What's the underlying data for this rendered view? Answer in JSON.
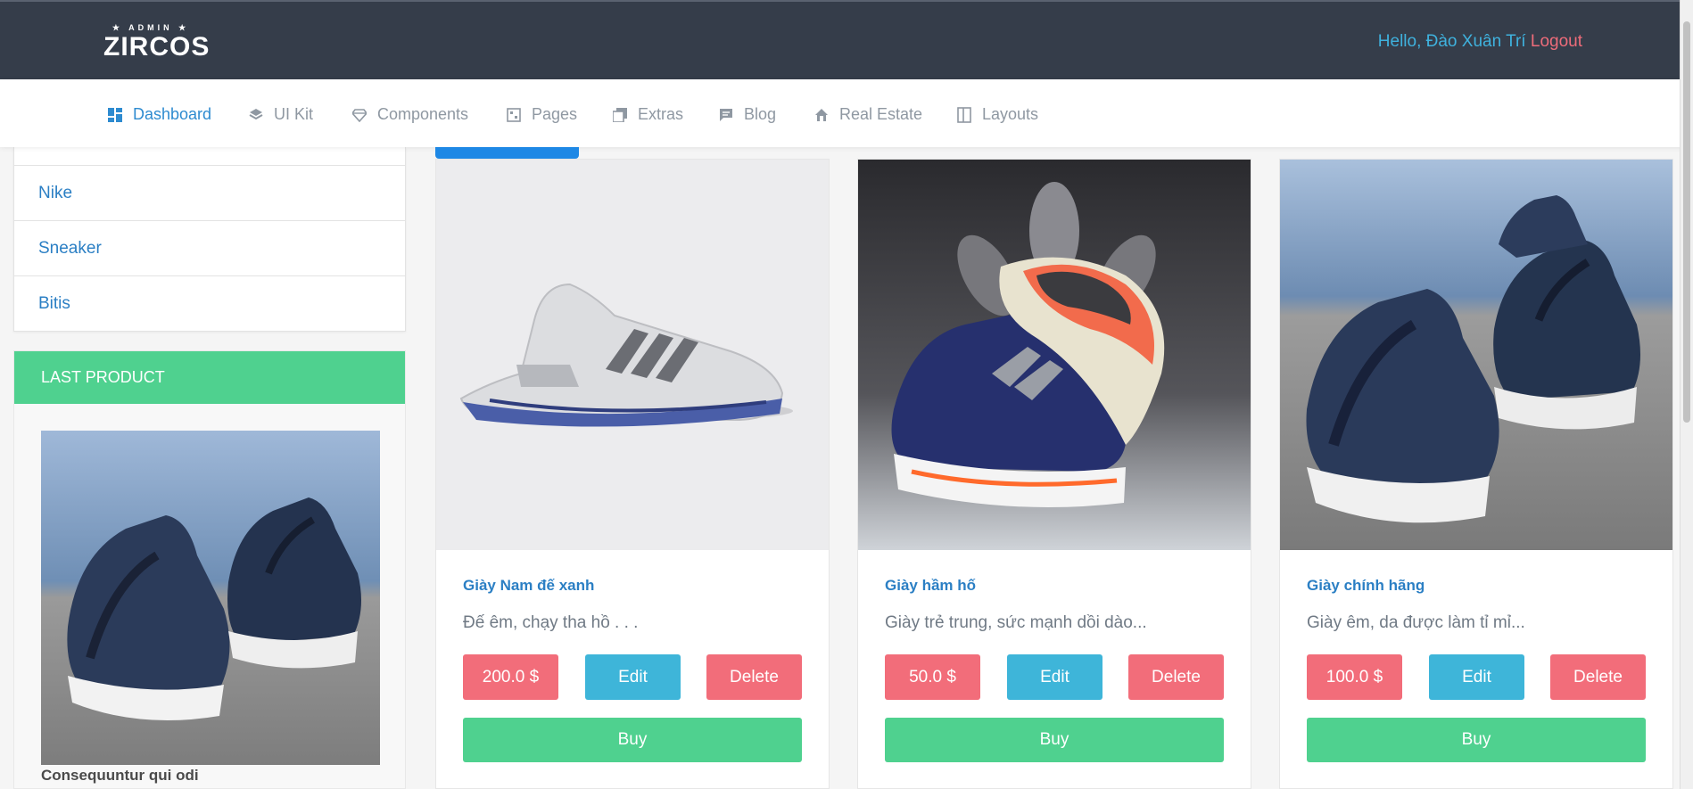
{
  "header": {
    "logo_small": "★ ADMIN ★",
    "logo_big": "ZIRCOS",
    "greeting": "Hello, Đào Xuân Trí",
    "logout": "Logout"
  },
  "nav": [
    {
      "label": "Dashboard",
      "icon": "dashboard-icon"
    },
    {
      "label": "UI Kit",
      "icon": "layers-icon"
    },
    {
      "label": "Components",
      "icon": "diamond-icon"
    },
    {
      "label": "Pages",
      "icon": "pages-icon"
    },
    {
      "label": "Extras",
      "icon": "copy-icon"
    },
    {
      "label": "Blog",
      "icon": "comment-icon"
    },
    {
      "label": "Real Estate",
      "icon": "home-icon"
    },
    {
      "label": "Layouts",
      "icon": "layout-icon"
    }
  ],
  "categories": [
    "Nike",
    "Sneaker",
    "Bitis"
  ],
  "last_product": {
    "header": "LAST PRODUCT",
    "name": "Consequuntur qui odi"
  },
  "products": [
    {
      "title": "Giày Nam đế xanh",
      "desc": "Đế êm, chạy tha hồ . . .",
      "price": "200.0 $",
      "edit": "Edit",
      "delete": "Delete",
      "buy": "Buy"
    },
    {
      "title": "Giày hầm hố",
      "desc": "Giày trẻ trung, sức mạnh dồi dào...",
      "price": "50.0 $",
      "edit": "Edit",
      "delete": "Delete",
      "buy": "Buy"
    },
    {
      "title": "Giày chính hãng",
      "desc": "Giày êm, da được làm tỉ mỉ...",
      "price": "100.0 $",
      "edit": "Edit",
      "delete": "Delete",
      "buy": "Buy"
    }
  ],
  "colors": {
    "topbar": "#353d4a",
    "accent_blue": "#2e8bd0",
    "green": "#4fd18f",
    "red": "#f26d7a",
    "cyan": "#3eb5d9"
  }
}
